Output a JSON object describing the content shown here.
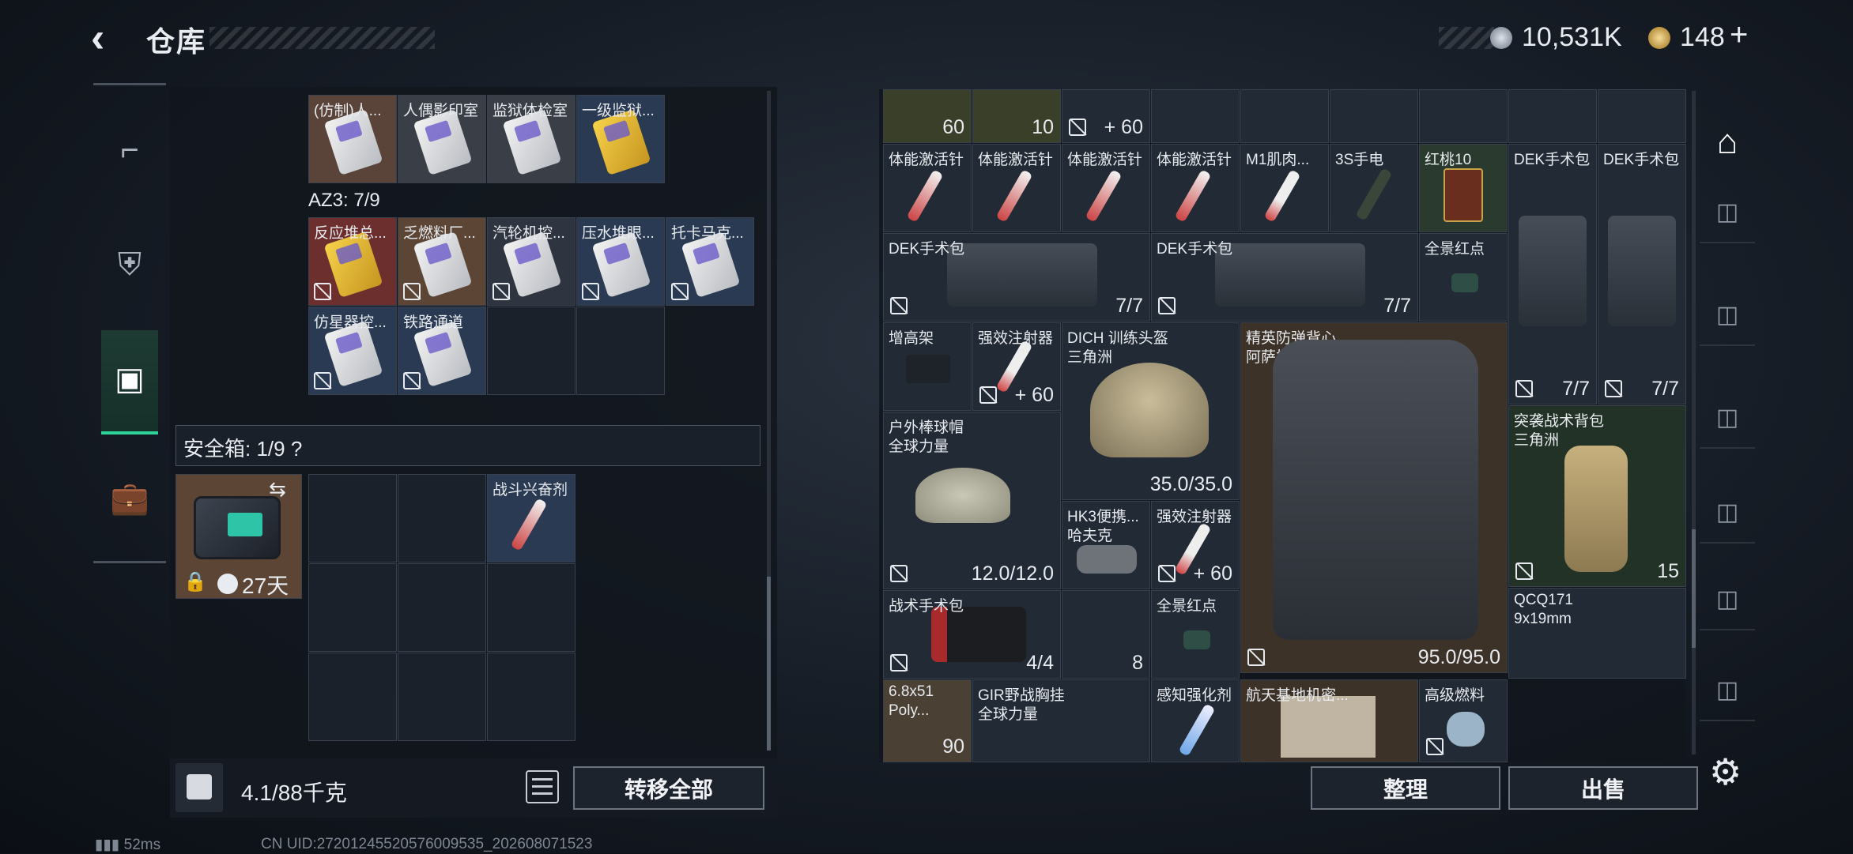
{
  "header": {
    "back_glyph": "‹",
    "title": "仓库",
    "money": "10,531K",
    "tokens": "148",
    "plus": "+"
  },
  "safebox": {
    "label": "安全箱: 1/9",
    "help": "?",
    "days": "27天"
  },
  "az": {
    "label": "AZ3: 7/9"
  },
  "weight": {
    "text": "4.1/88千克",
    "transfer": "转移全部"
  },
  "right_buttons": {
    "sort": "整理",
    "sell": "出售"
  },
  "status": {
    "ping": "52ms",
    "uid": "CN UID:27201245520576009535_202608071523"
  },
  "keycards_row1": [
    "(仿制)人...",
    "人偶影印室",
    "监狱体检室",
    "一级监狱..."
  ],
  "keycards_row2": [
    "反应堆总...",
    "乏燃料厂...",
    "汽轮机控...",
    "压水堆眼...",
    "托卡马克..."
  ],
  "keycards_row3": [
    "仿星器控...",
    "铁路通道"
  ],
  "safebox_item": "战斗兴奋剂",
  "right_items": {
    "top_counts": [
      "60",
      "10",
      "+ 60"
    ],
    "row2": [
      "体能激活针",
      "体能激活针",
      "体能激活针",
      "体能激活针",
      "M1肌肉...",
      "3S手电",
      "红桃10",
      "DEK手术包",
      "DEK手术包"
    ],
    "dek1": "DEK手术包",
    "dek1_count": "7/7",
    "dek2": "DEK手术包",
    "dek2_count": "7/7",
    "redot1": "全景红点",
    "dek_v_counts": [
      "7/7",
      "7/7"
    ],
    "stand": "增高架",
    "inj1": "强效注射器",
    "inj1_count": "+ 60",
    "helmet": "DICH 训练头盔",
    "helmet_sub": "三角洲",
    "helmet_count": "35.0/35.0",
    "vest": "精英防弹背心",
    "vest_sub": "阿萨拉",
    "vest_count": "95.0/95.0",
    "cap": "户外棒球帽",
    "cap_sub": "全球力量",
    "cap_count": "12.0/12.0",
    "hk3": "HK3便携...",
    "hk3_sub": "哈夫克",
    "inj2": "强效注射器",
    "inj2_count": "+ 60",
    "bag": "突袭战术背包",
    "bag_sub": "三角洲",
    "bag_count": "15",
    "medkit": "战术手术包",
    "medkit_count": "4/4",
    "hk3_count": "8",
    "redot2": "全景红点",
    "qcq": "QCQ171",
    "qcq_sub": "9x19mm",
    "ammo": "6.8x51",
    "ammo_sub": "Poly...",
    "ammo_count": "90",
    "gir": "GIR野战胸挂",
    "gir_sub": "全球力量",
    "sense": "感知强化剂",
    "doc": "航天基地机密...",
    "fuel": "高级燃料"
  }
}
